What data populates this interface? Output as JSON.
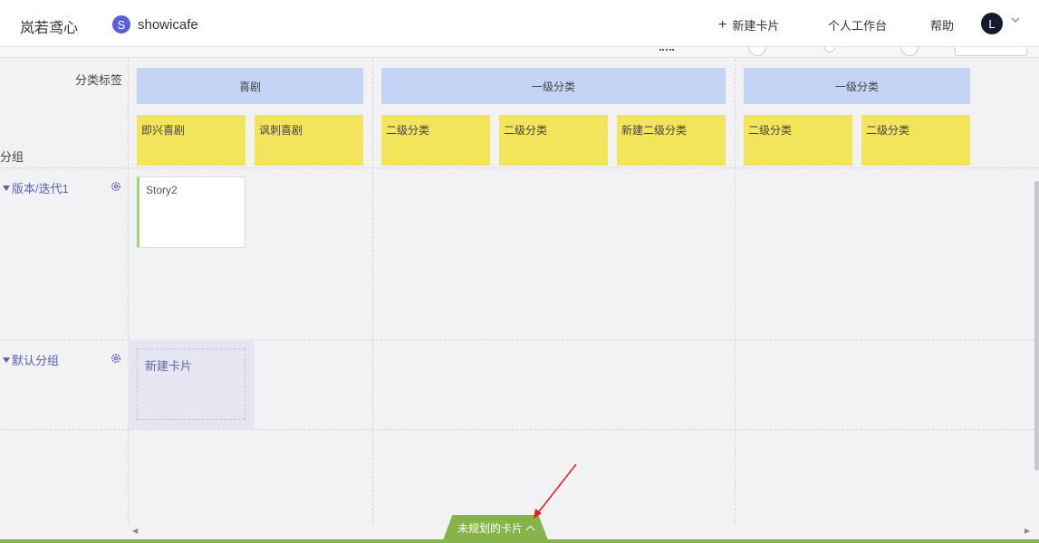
{
  "header": {
    "brand": "岚若鸢心",
    "project_icon_letter": "S",
    "project_name": "showicafe",
    "new_card": "新建卡片",
    "workspace": "个人工作台",
    "help": "帮助",
    "avatar_letter": "L"
  },
  "board": {
    "category_label": "分类标签",
    "group_label": "分组",
    "level1": [
      "喜剧",
      "一级分类",
      "一级分类"
    ],
    "level2": [
      "即兴喜剧",
      "讽刺喜剧",
      "二级分类",
      "二级分类",
      "新建二级分类",
      "二级分类",
      "二级分类"
    ],
    "rows": [
      {
        "title": "版本/迭代1"
      },
      {
        "title": "默认分组"
      }
    ],
    "story_card": "Story2",
    "new_card_placeholder": "新建卡片"
  },
  "footer": {
    "unplanned_tab": "未规划的卡片"
  },
  "colors": {
    "accent_green": "#86b34a",
    "category_blue": "#c3d4f4",
    "category_yellow": "#f2e55c",
    "link_purple": "#5a5fb8"
  }
}
